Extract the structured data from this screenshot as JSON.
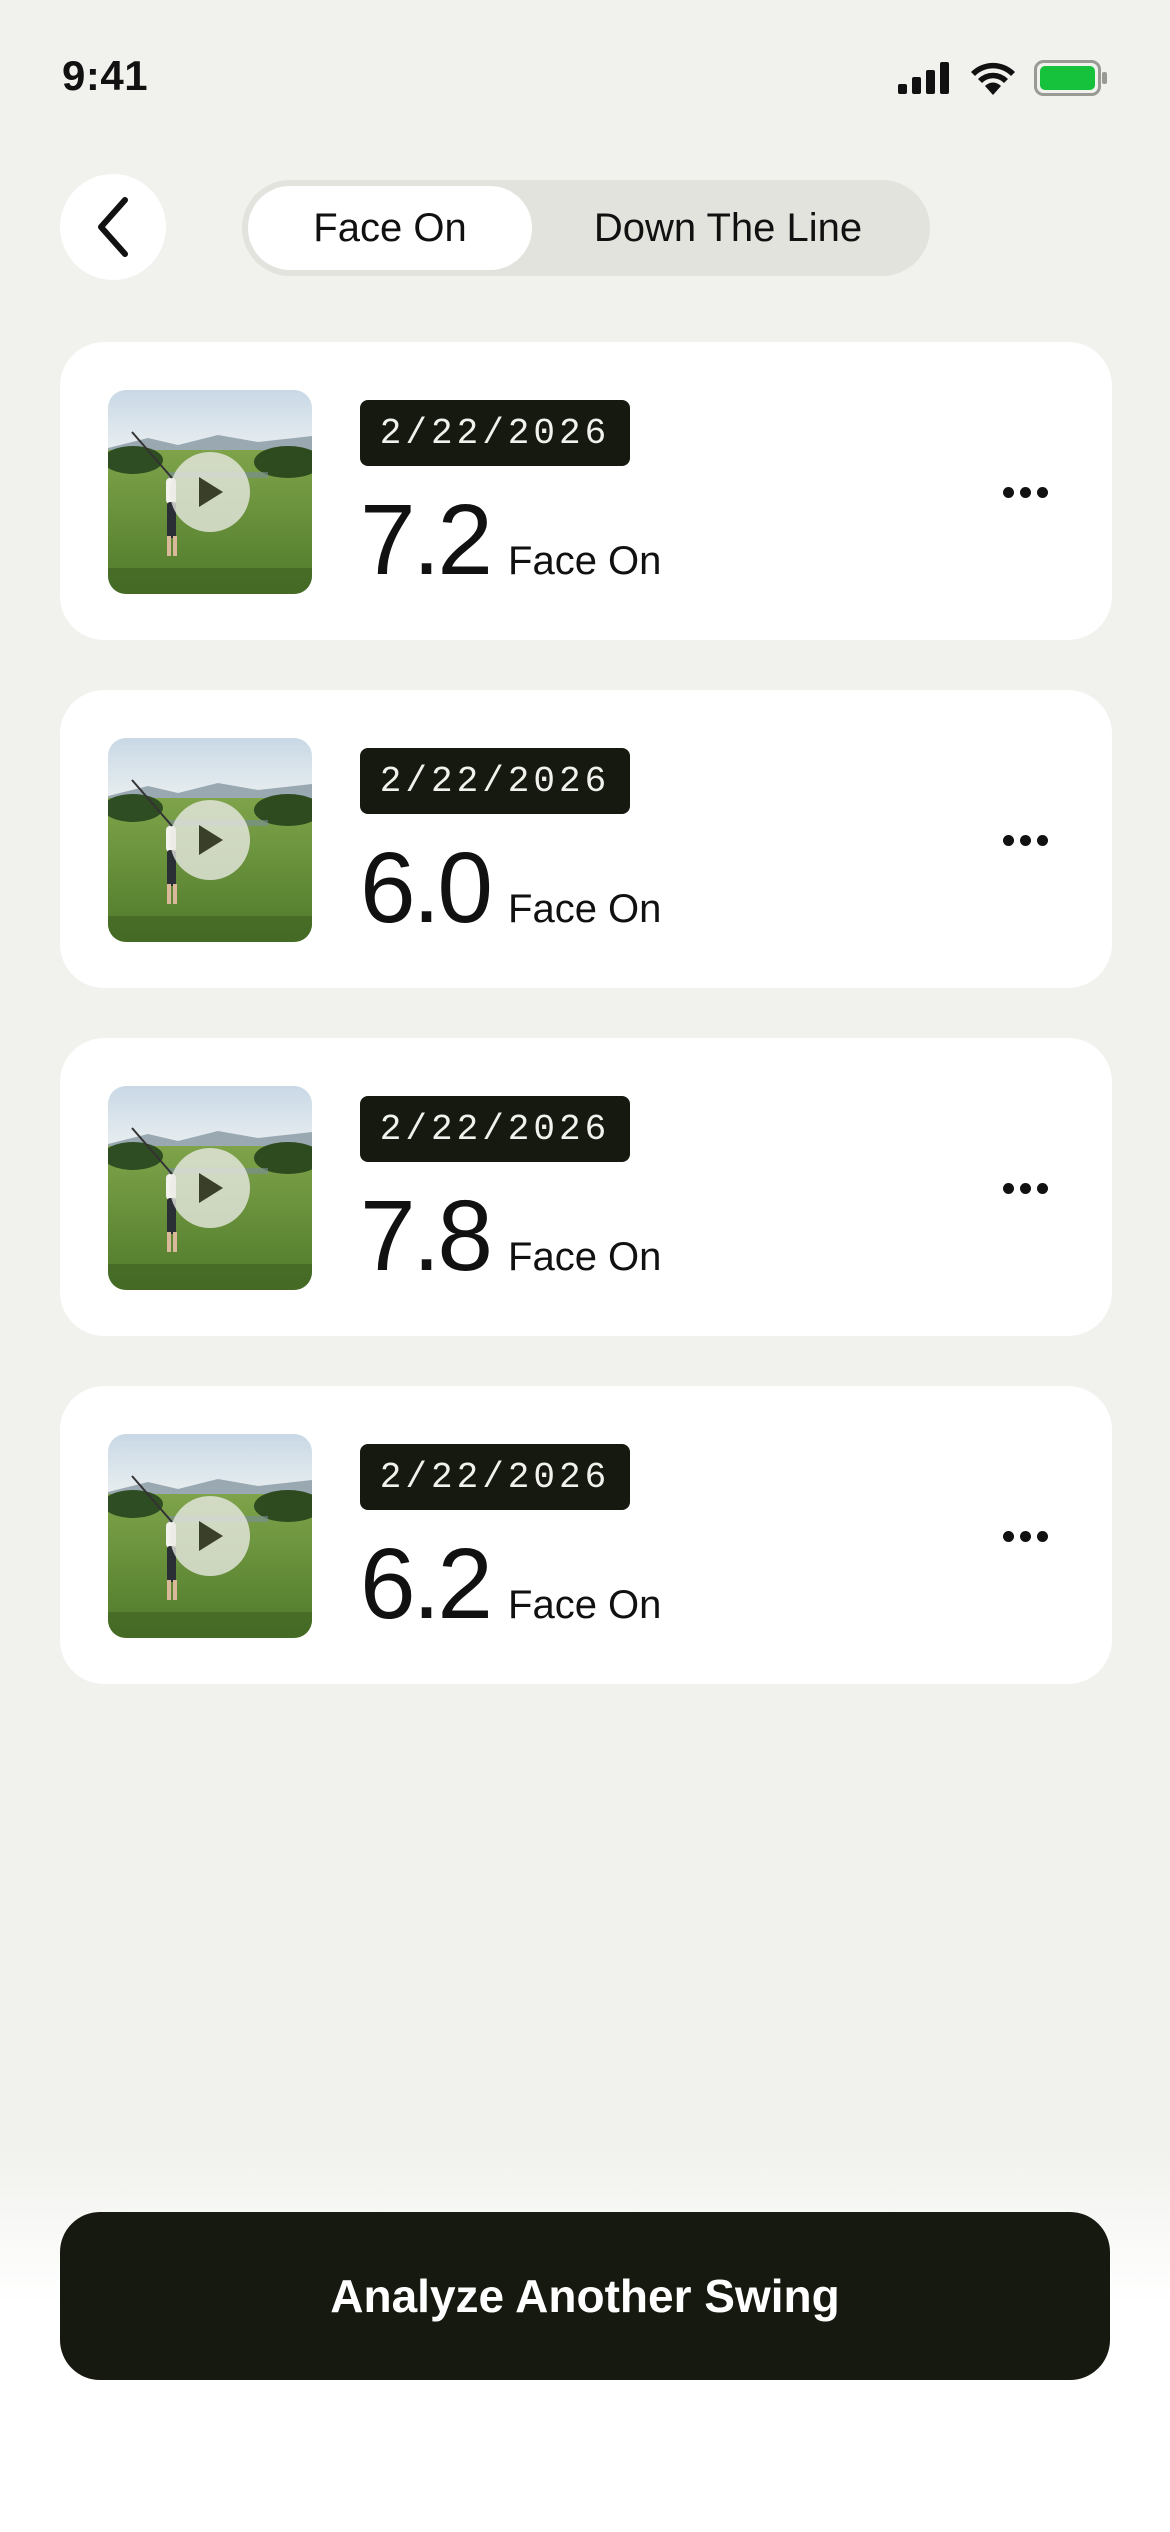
{
  "status_bar": {
    "time": "9:41",
    "battery_color": "#16c13c"
  },
  "header": {
    "back_icon": "chevron-left-icon",
    "tabs": [
      {
        "label": "Face On",
        "active": true
      },
      {
        "label": "Down The Line",
        "active": false
      }
    ]
  },
  "swings": [
    {
      "date": "2/22/2026",
      "score": "7.2",
      "view": "Face On"
    },
    {
      "date": "2/22/2026",
      "score": "6.0",
      "view": "Face On"
    },
    {
      "date": "2/22/2026",
      "score": "7.8",
      "view": "Face On"
    },
    {
      "date": "2/22/2026",
      "score": "6.2",
      "view": "Face On"
    }
  ],
  "cta": {
    "label": "Analyze Another Swing"
  },
  "colors": {
    "background": "#f1f1ed",
    "dark": "#16190f",
    "card": "#ffffff"
  }
}
